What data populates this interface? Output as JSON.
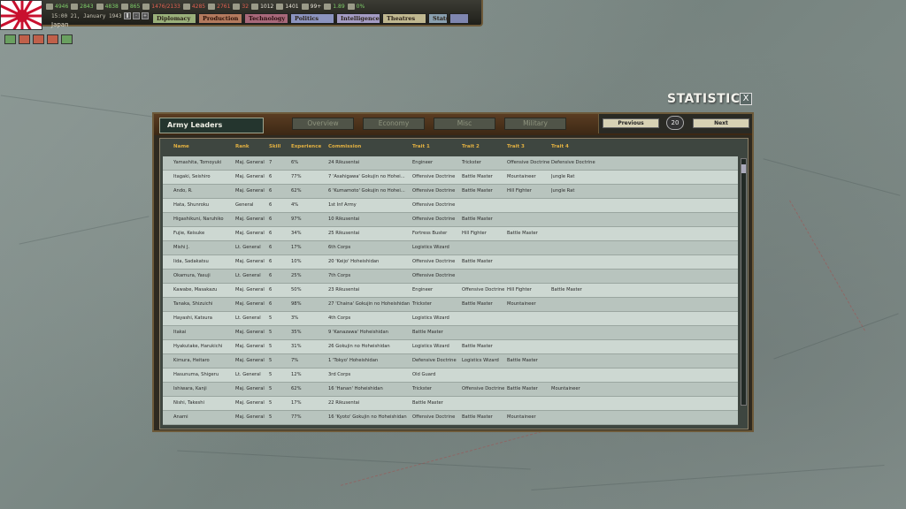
{
  "topbar": {
    "date": "15:00 21, January 1943",
    "country": "Japan",
    "resources": [
      {
        "icon": "energy-icon",
        "value": "4946",
        "color": "green"
      },
      {
        "icon": "metal-icon",
        "value": "2843",
        "color": "green"
      },
      {
        "icon": "rare-materials-icon",
        "value": "4838",
        "color": "green"
      },
      {
        "icon": "oil-icon",
        "value": "865",
        "color": "green"
      },
      {
        "icon": "supplies-icon",
        "value": "1476/2133",
        "color": "red"
      },
      {
        "icon": "fuel-icon",
        "value": "4285",
        "color": "red"
      },
      {
        "icon": "money-icon",
        "value": "2761",
        "color": "red"
      },
      {
        "icon": "money2-icon",
        "value": "32",
        "color": "red"
      },
      {
        "icon": "manpower-icon",
        "value": "1012",
        "color": "white"
      },
      {
        "icon": "transport-icon",
        "value": "1401",
        "color": "white"
      },
      {
        "icon": "escort-icon",
        "value": "99+",
        "color": "white"
      },
      {
        "icon": "dissent-icon",
        "value": "1.89",
        "color": "green"
      },
      {
        "icon": "nu-icon",
        "value": "0%",
        "color": "green"
      }
    ],
    "tabs": [
      "Diplomacy",
      "Production",
      "Technology",
      "Politics",
      "Intelligence",
      "Theatres"
    ],
    "small_tabs": [
      "Stats",
      ""
    ]
  },
  "stats": {
    "title": "STATISTICS",
    "close": "X",
    "section": "Army Leaders",
    "subtabs": [
      "Overview",
      "Economy",
      "Misc",
      "Military"
    ],
    "prev": "Previous",
    "page": "20",
    "next": "Next",
    "headers": [
      "Name",
      "Rank",
      "Skill",
      "Experience",
      "Commission",
      "Trait 1",
      "Trait 2",
      "Trait 3",
      "Trait 4"
    ],
    "rows": [
      [
        "Yamashita, Tomoyuki",
        "Maj. General",
        "7",
        "6%",
        "24 Rikusentai",
        "Engineer",
        "Trickster",
        "Offensive Doctrine",
        "Defensive Doctrine"
      ],
      [
        "Itagaki, Seishiro",
        "Maj. General",
        "6",
        "77%",
        "7 'Asahigawa' Gokujin no Hohei...",
        "Offensive Doctrine",
        "Battle Master",
        "Mountaineer",
        "Jungle Rat"
      ],
      [
        "Ando, R.",
        "Maj. General",
        "6",
        "62%",
        "6 'Kumamoto' Gokujin no Hohei...",
        "Offensive Doctrine",
        "Battle Master",
        "Hill Fighter",
        "Jungle Rat"
      ],
      [
        "Hata, Shunroku",
        "General",
        "6",
        "4%",
        "1st Inf Army",
        "Offensive Doctrine",
        "",
        "",
        ""
      ],
      [
        "Higashikuni, Naruhiko",
        "Maj. General",
        "6",
        "97%",
        "10 Rikusentai",
        "Offensive Doctrine",
        "Battle Master",
        "",
        ""
      ],
      [
        "Fujie, Keisuke",
        "Maj. General",
        "6",
        "34%",
        "25 Rikusentai",
        "Fortress Buster",
        "Hill Fighter",
        "Battle Master",
        ""
      ],
      [
        "Mishi J.",
        "Lt. General",
        "6",
        "17%",
        "6th Corps",
        "Logistics Wizard",
        "",
        "",
        ""
      ],
      [
        "Iida, Sadakatsu",
        "Maj. General",
        "6",
        "10%",
        "20 'Keijo' Hoheishidan",
        "Offensive Doctrine",
        "Battle Master",
        "",
        ""
      ],
      [
        "Okamura, Yasuji",
        "Lt. General",
        "6",
        "25%",
        "7th Corps",
        "Offensive Doctrine",
        "",
        "",
        ""
      ],
      [
        "Kawabe, Masakazu",
        "Maj. General",
        "6",
        "50%",
        "23 Rikusentai",
        "Engineer",
        "Offensive Doctrine",
        "Hill Fighter",
        "Battle Master"
      ],
      [
        "Tanaka, Shizuichi",
        "Maj. General",
        "6",
        "98%",
        "27 'Chaina' Gokujin no Hoheishidan",
        "Trickster",
        "Battle Master",
        "Mountaineer",
        ""
      ],
      [
        "Hayashi, Katsura",
        "Lt. General",
        "5",
        "3%",
        "4th Corps",
        "Logistics Wizard",
        "",
        "",
        ""
      ],
      [
        "Itakai",
        "Maj. General",
        "5",
        "35%",
        "9 'Kanazawa' Hoheishidan",
        "Battle Master",
        "",
        "",
        ""
      ],
      [
        "Hyakutake, Harukichi",
        "Maj. General",
        "5",
        "31%",
        "26 Gokujin no Hoheishidan",
        "Logistics Wizard",
        "Battle Master",
        "",
        ""
      ],
      [
        "Kimura, Heitaro",
        "Maj. General",
        "5",
        "7%",
        "1 'Tokyo' Hoheishidan",
        "Defensive Doctrine",
        "Logistics Wizard",
        "Battle Master",
        ""
      ],
      [
        "Hasunuma, Shigeru",
        "Lt. General",
        "5",
        "12%",
        "3rd Corps",
        "Old Guard",
        "",
        "",
        ""
      ],
      [
        "Ishiwara, Kanji",
        "Maj. General",
        "5",
        "62%",
        "16 'Hanan' Hoheishidan",
        "Trickster",
        "Offensive Doctrine",
        "Battle Master",
        "Mountaineer"
      ],
      [
        "Nishi, Takeshi",
        "Maj. General",
        "5",
        "17%",
        "22 Rikusentai",
        "Battle Master",
        "",
        "",
        ""
      ],
      [
        "Anami",
        "Maj. General",
        "5",
        "77%",
        "16 'Kyoto' Gokujin no Hoheishidan",
        "Offensive Doctrine",
        "Battle Master",
        "Mountaineer",
        ""
      ]
    ]
  }
}
